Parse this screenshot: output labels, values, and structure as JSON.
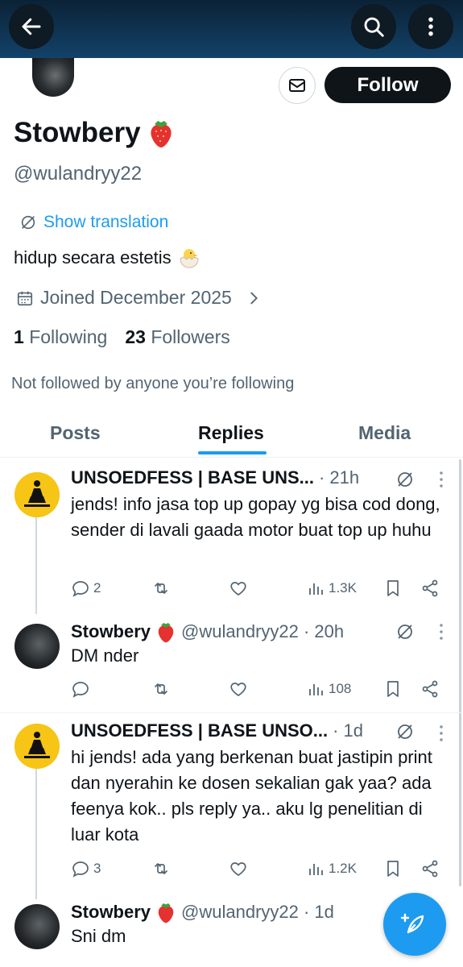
{
  "header": {
    "back_icon": "arrow-left-icon",
    "search_icon": "search-icon",
    "more_icon": "more-vertical-icon"
  },
  "profile": {
    "display_name": "Stowbery",
    "handle": "@wulandryy22",
    "translation_label": "Show translation",
    "bio": "hidup secara estetis",
    "joined": "Joined December 2025",
    "following_count": "1",
    "following_label": "Following",
    "followers_count": "23",
    "followers_label": "Followers",
    "not_followed": "Not followed by anyone you’re following",
    "follow_label": "Follow"
  },
  "tabs": [
    {
      "label": "Posts"
    },
    {
      "label": "Replies"
    },
    {
      "label": "Media"
    }
  ],
  "posts": [
    {
      "name": "UNSOEDFESS | BASE UNS...",
      "meta": "· 21h",
      "text": "jends! info jasa top up gopay yg bisa cod dong, sender di lavali gaada motor buat top up huhu",
      "replies": "2",
      "views": "1.3K"
    },
    {
      "name": "Stowbery",
      "meta": "@wulandryy22 · 20h",
      "text": "DM nder",
      "replies": "",
      "views": "108"
    },
    {
      "name": "UNSOEDFESS | BASE UNSO...",
      "meta": "· 1d",
      "text": "hi jends! ada yang berkenan buat jastipin print dan nyerahin ke dosen sekalian gak yaa? ada feenya kok.. pls reply ya.. aku lg penelitian di luar kota",
      "replies": "3",
      "views": "1.2K"
    },
    {
      "name": "Stowbery",
      "meta": "@wulandryy22 · 1d",
      "text": "Sni dm",
      "replies": "",
      "views": ""
    }
  ],
  "colors": {
    "accent": "#1d9bf0",
    "text_secondary": "#536471",
    "follow_button": "#0f1419",
    "banner": "#13426a"
  }
}
